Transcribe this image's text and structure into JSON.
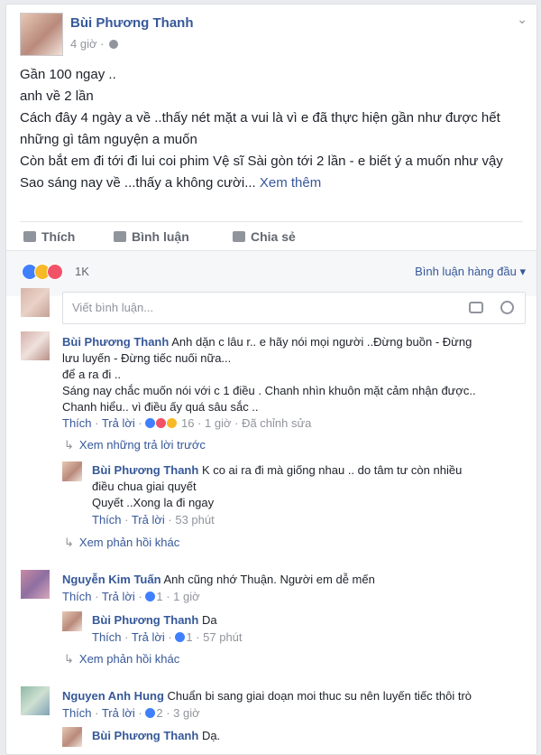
{
  "post": {
    "author": "Bùi Phương Thanh",
    "time": "4 giờ",
    "lines": [
      "Gần 100 ngay ..",
      "anh về 2 lần",
      "Cách đây 4 ngày a về ..thấy nét mặt a vui là vì e đã thực hiện gần như được hết những gì tâm nguyện a muốn",
      "Còn bắt em đi tới đi lui coi phim Vệ sĩ Sài gòn tới 2 lần - e biết ý a muốn như vậy",
      "Sao sáng nay về ...thấy a không cười..."
    ],
    "see_more": "Xem thêm"
  },
  "actions": {
    "like": "Thích",
    "comment": "Bình luận",
    "share": "Chia sẻ"
  },
  "reactions": {
    "count": "1K",
    "sort_label": "Bình luận hàng đầu"
  },
  "comment_input": {
    "placeholder": "Viết bình luận..."
  },
  "comments": [
    {
      "author": "Bùi Phương Thanh",
      "text_line1": "Anh dặn c lâu r.. e hãy nói mọi người ..Đừng buồn - Đừng",
      "text_line2": "lưu luyến - Đừng tiếc nuối nữa...",
      "text_line3": "để a ra đi ..",
      "text_line4": "Sáng nay chắc muốn nói với c 1 điều . Chanh nhìn khuôn mặt cảm nhận được..",
      "text_line5": "Chanh hiểu.. vì điều ấy quá sâu sắc ..",
      "like": "Thích",
      "reply": "Trả lời",
      "react_count": "16",
      "time": "1 giờ",
      "edited": "Đã chỉnh sửa",
      "prev_replies": "Xem những trả lời trước",
      "reply_item": {
        "author": "Bùi Phương Thanh",
        "text_line1": "K co ai ra đi mà giống nhau .. do tâm tư còn nhiều",
        "text_line2": "điều chua giai quyết",
        "text_line3": "Quyết ..Xong la đi ngay",
        "like": "Thích",
        "reply": "Trả lời",
        "time": "53 phút"
      },
      "more_replies": "Xem phản hồi khác"
    },
    {
      "author": "Nguyễn Kim Tuấn",
      "text": "Anh cũng nhớ Thuận. Người em dễ mến",
      "like": "Thích",
      "reply": "Trả lời",
      "react_count": "1",
      "time": "1 giờ",
      "reply_item": {
        "author": "Bùi Phương Thanh",
        "text": "Da",
        "like": "Thích",
        "reply": "Trả lời",
        "react_count": "1",
        "time": "57 phút"
      },
      "more_replies": "Xem phản hồi khác"
    },
    {
      "author": "Nguyen Anh Hung",
      "text": "Chuẩn bi sang giai doạn moi thuc su nên luyến tiếc thôi trò",
      "like": "Thích",
      "reply": "Trả lời",
      "react_count": "2",
      "time": "3 giờ",
      "reply_item": {
        "author": "Bùi Phương Thanh",
        "text": "Dạ."
      }
    }
  ],
  "colors": {
    "link": "#365899",
    "meta": "#90949c",
    "like_blue": "#4080ff",
    "love_red": "#f25268",
    "haha_yellow": "#f7b928"
  }
}
